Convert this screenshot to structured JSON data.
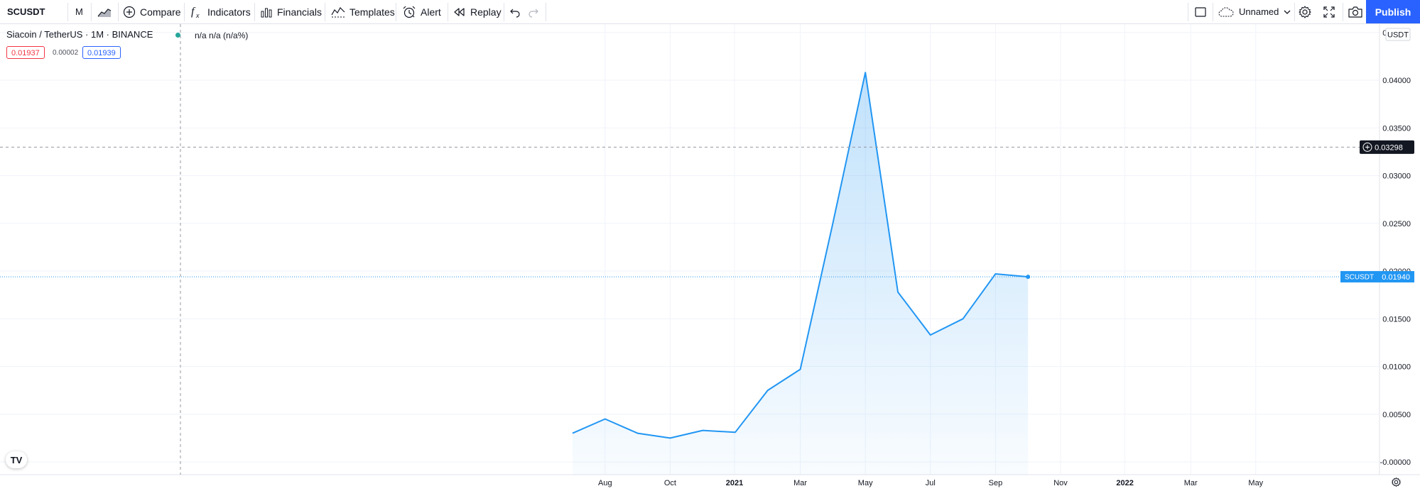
{
  "toolbar": {
    "symbol": "SCUSDT",
    "interval": "M",
    "compare": "Compare",
    "indicators": "Indicators",
    "financials": "Financials",
    "templates": "Templates",
    "alert": "Alert",
    "replay": "Replay",
    "layout_name": "Unnamed",
    "publish": "Publish"
  },
  "legend": {
    "title": "Siacoin / TetherUS · 1M · BINANCE",
    "values": "n/a n/a (n/a%)",
    "sell_price": "0.01937",
    "spread": "0.00002",
    "buy_price": "0.01939"
  },
  "chart_data": {
    "type": "area",
    "series": [
      {
        "name": "SCUSDT",
        "x": [
          "2020-07",
          "2020-08",
          "2020-09",
          "2020-10",
          "2020-11",
          "2020-12",
          "2021-01",
          "2021-02",
          "2021-03",
          "2021-04",
          "2021-05",
          "2021-06",
          "2021-07",
          "2021-08",
          "2021-09"
        ],
        "values": [
          0.003,
          0.0045,
          0.003,
          0.0025,
          0.0033,
          0.0031,
          0.0075,
          0.0097,
          0.025,
          0.0408,
          0.0178,
          0.0133,
          0.015,
          0.0197,
          0.0194
        ]
      }
    ],
    "y_ticks": [
      "0.04500",
      "0.04000",
      "0.03500",
      "0.03000",
      "0.02500",
      "0.02000",
      "0.01500",
      "0.01000",
      "0.00500",
      "-0.00000"
    ],
    "x_ticks": [
      {
        "label": "Aug",
        "bold": false
      },
      {
        "label": "Oct",
        "bold": false
      },
      {
        "label": "2021",
        "bold": true
      },
      {
        "label": "Mar",
        "bold": false
      },
      {
        "label": "May",
        "bold": false
      },
      {
        "label": "Jul",
        "bold": false
      },
      {
        "label": "Sep",
        "bold": false
      },
      {
        "label": "Nov",
        "bold": false
      },
      {
        "label": "2022",
        "bold": true
      },
      {
        "label": "Mar",
        "bold": false
      },
      {
        "label": "May",
        "bold": false
      }
    ],
    "currency_label": "USDT",
    "last_price_symbol": "SCUSDT",
    "last_price_label": "0.01940",
    "last_price": 0.0194,
    "crosshair_label": "0.03298",
    "crosshair_price": 0.03298,
    "grid": true,
    "colors": {
      "line": "#2196f3",
      "fill": "#2196f3",
      "crosshair_badge": "#131722",
      "last_price_badge": "#2196f3"
    }
  },
  "icons": {
    "compare": "plus-circle-icon",
    "indicators": "fx-icon",
    "financials": "bar-chart-icon",
    "templates": "templates-icon",
    "alert": "alarm-clock-icon",
    "replay": "rewind-icon",
    "undo": "undo-icon",
    "redo": "redo-icon",
    "fullscreen": "fullscreen-icon",
    "snapshot": "camera-icon",
    "settings": "gear-icon"
  }
}
